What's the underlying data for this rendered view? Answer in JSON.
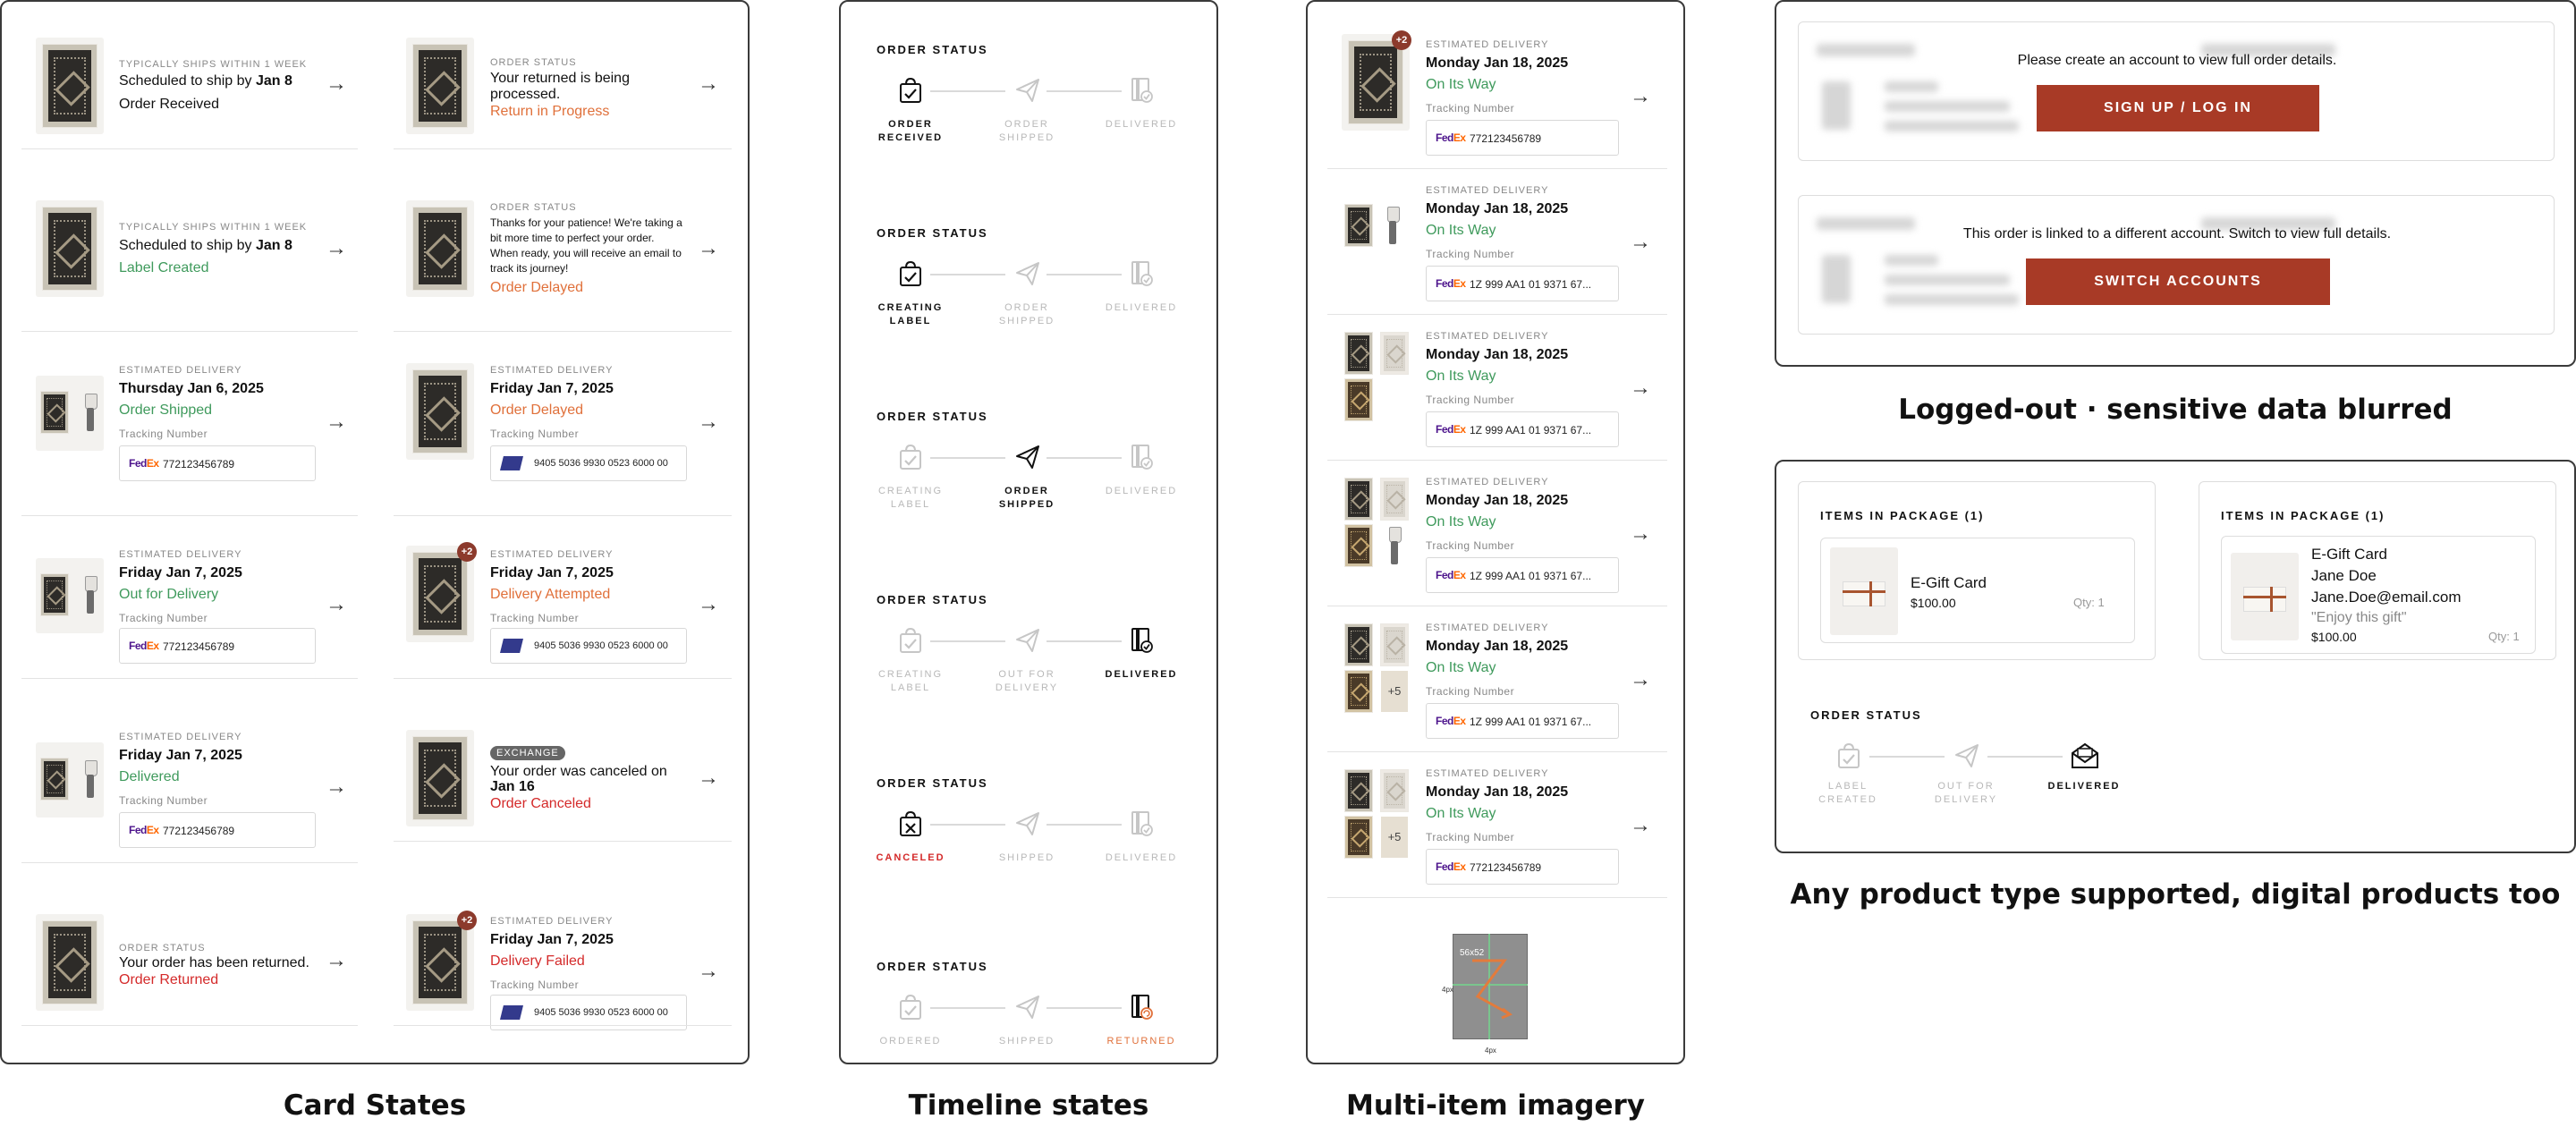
{
  "captions": {
    "card_states": "Card States",
    "timeline_states": "Timeline states",
    "multi_item": "Multi-item imagery",
    "logged_out": "Logged-out · sensitive data blurred",
    "any_product": "Any product type supported, digital products too"
  },
  "card_states": {
    "c1": {
      "label": "TYPICALLY SHIPS WITHIN 1 WEEK",
      "line1": "Scheduled to ship by",
      "line1b": "Jan 8",
      "status": "Order Received"
    },
    "c2": {
      "label": "ORDER STATUS",
      "line1": "Your returned is being",
      "line2": "processed.",
      "status": "Return in Progress"
    },
    "c3": {
      "label": "TYPICALLY SHIPS WITHIN 1 WEEK",
      "line1": "Scheduled to ship by",
      "line1b": "Jan 8",
      "status": "Label Created"
    },
    "c4": {
      "label": "ORDER STATUS",
      "l1": "Thanks for your patience! We're taking a",
      "l2": "bit more time to perfect your order.",
      "l3": "When ready, you will receive an email to",
      "l4": "track its journey!",
      "status": "Order Delayed"
    },
    "c5": {
      "label": "ESTIMATED DELIVERY",
      "date": "Thursday Jan 6, 2025",
      "status": "Order Shipped",
      "track_label": "Tracking Number",
      "tracking": "772123456789"
    },
    "c6": {
      "label": "ESTIMATED DELIVERY",
      "date": "Friday Jan 7, 2025",
      "status": "Order Delayed",
      "track_label": "Tracking Number",
      "tracking": "9405 5036 9930 0523 6000 00"
    },
    "c7": {
      "label": "ESTIMATED DELIVERY",
      "date": "Friday Jan 7, 2025",
      "status": "Out for Delivery",
      "track_label": "Tracking Number",
      "tracking": "772123456789"
    },
    "c8": {
      "label": "ESTIMATED DELIVERY",
      "date": "Friday Jan 7, 2025",
      "status": "Delivery Attempted",
      "track_label": "Tracking Number",
      "tracking": "9405 5036 9930 0523 6000 00",
      "badge": "+2"
    },
    "c9": {
      "label": "ESTIMATED DELIVERY",
      "date": "Friday Jan 7, 2025",
      "status": "Delivered",
      "track_label": "Tracking Number",
      "tracking": "772123456789"
    },
    "c10": {
      "tag": "EXCHANGE",
      "line1": "Your order was canceled on",
      "line2": "Jan 16",
      "status": "Order Canceled"
    },
    "c11": {
      "label": "ORDER STATUS",
      "line1": "Your order has been returned.",
      "status": "Order Returned"
    },
    "c12": {
      "label": "ESTIMATED DELIVERY",
      "date": "Friday Jan 7, 2025",
      "status": "Delivery Failed",
      "track_label": "Tracking Number",
      "tracking": "9405 5036 9930 0523 6000 00",
      "badge": "+2"
    },
    "fedex1": "Fed",
    "fedex2": "Ex"
  },
  "timelines": [
    {
      "title": "ORDER STATUS",
      "steps": [
        "ORDER RECEIVED",
        "ORDER SHIPPED",
        "DELIVERED"
      ]
    },
    {
      "title": "ORDER STATUS",
      "steps": [
        "CREATING LABEL",
        "ORDER SHIPPED",
        "DELIVERED"
      ]
    },
    {
      "title": "ORDER STATUS",
      "steps": [
        "CREATING LABEL",
        "ORDER SHIPPED",
        "DELIVERED"
      ]
    },
    {
      "title": "ORDER STATUS",
      "steps": [
        "CREATING LABEL",
        "OUT FOR DELIVERY",
        "DELIVERED"
      ]
    },
    {
      "title": "ORDER STATUS",
      "steps": [
        "CANCELED",
        "SHIPPED",
        "DELIVERED"
      ]
    },
    {
      "title": "ORDER STATUS",
      "steps": [
        "ORDERED",
        "SHIPPED",
        "RETURNED"
      ]
    }
  ],
  "multi_item": {
    "label": "ESTIMATED DELIVERY",
    "date": "Monday Jan 18, 2025",
    "status": "On Its Way",
    "track_label": "Tracking Number",
    "tracking_fedex": "772123456789",
    "tracking_ups": "1Z 999 AA1 01 9371 67...",
    "badge": "+2",
    "more": "+5",
    "spec_size": "56x52",
    "spec_gap1": "4px",
    "spec_gap2": "4px"
  },
  "logged_out": {
    "msg1": "Please create an account to view full order details.",
    "btn1": "SIGN UP / LOG IN",
    "msg2": "This order is linked to a different account. Switch to view full details.",
    "btn2": "SWITCH ACCOUNTS"
  },
  "digital": {
    "pkg_title": "ITEMS IN PACKAGE (1)",
    "item_name": "E-Gift Card",
    "price": "$100.00",
    "qty": "Qty: 1",
    "recipient": "Jane Doe",
    "email": "Jane.Doe@email.com",
    "note": "\"Enjoy this gift\"",
    "status_title": "ORDER STATUS",
    "steps": [
      "LABEL CREATED",
      "OUT FOR DELIVERY",
      "DELIVERED"
    ]
  }
}
